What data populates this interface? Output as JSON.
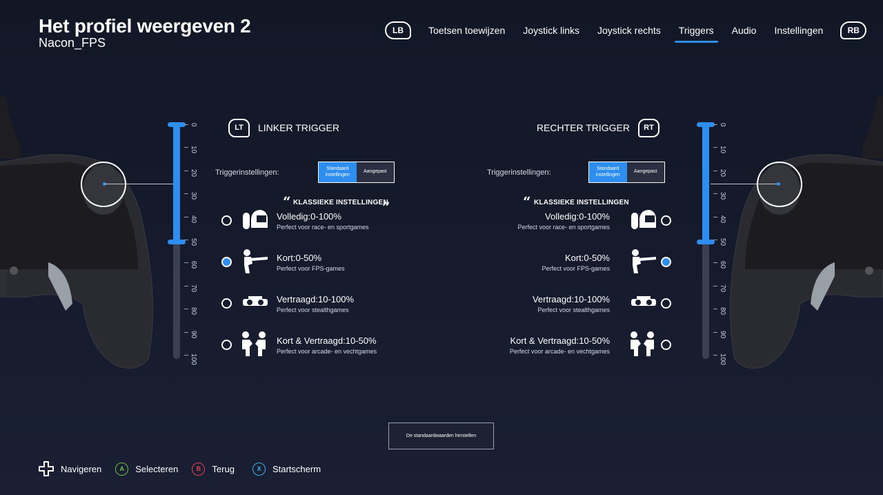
{
  "header": {
    "title": "Het profiel weergeven 2",
    "subtitle": "Nacon_FPS"
  },
  "nav": {
    "left_bumper": "LB",
    "right_bumper": "RB",
    "tabs": [
      {
        "label": "Toetsen toewijzen",
        "active": false
      },
      {
        "label": "Joystick links",
        "active": false
      },
      {
        "label": "Joystick rechts",
        "active": false
      },
      {
        "label": "Triggers",
        "active": true
      },
      {
        "label": "Audio",
        "active": false
      },
      {
        "label": "Instellingen",
        "active": false
      }
    ]
  },
  "slider": {
    "ticks": [
      "0",
      "10",
      "20",
      "30",
      "40",
      "50",
      "60",
      "70",
      "80",
      "90",
      "100"
    ],
    "value_percent": 50
  },
  "left_panel": {
    "icon": "LT",
    "title": "LINKER TRIGGER",
    "settings_label": "Triggerinstellingen:",
    "seg_standard": "Standaard instellingen",
    "seg_custom": "Aangepast",
    "section_title": "KLASSIEKE INSTELLINGEN",
    "options": [
      {
        "title": "Volledig:0-100%",
        "sub": "Perfect voor race- en sportgames",
        "icon": "helmet-icon",
        "checked": false
      },
      {
        "title": "Kort:0-50%",
        "sub": "Perfect voor FPS-games",
        "icon": "shooter-icon",
        "checked": true
      },
      {
        "title": "Vertraagd:10-100%",
        "sub": "Perfect voor stealthgames",
        "icon": "goggles-icon",
        "checked": false
      },
      {
        "title": "Kort & Vertraagd:10-50%",
        "sub": "Perfect voor arcade- en vechtgames",
        "icon": "fighters-icon",
        "checked": false
      }
    ]
  },
  "right_panel": {
    "icon": "RT",
    "title": "RECHTER TRIGGER",
    "settings_label": "Triggerinstellingen:",
    "seg_standard": "Standaard instellingen",
    "seg_custom": "Aangepast",
    "section_title": "KLASSIEKE INSTELLINGEN",
    "options": [
      {
        "title": "Volledig:0-100%",
        "sub": "Perfect voor race- en sportgames",
        "icon": "helmet-icon",
        "checked": false
      },
      {
        "title": "Kort:0-50%",
        "sub": "Perfect voor FPS-games",
        "icon": "shooter-icon",
        "checked": true
      },
      {
        "title": "Vertraagd:10-100%",
        "sub": "Perfect voor stealthgames",
        "icon": "goggles-icon",
        "checked": false
      },
      {
        "title": "Kort & Vertraagd:10-50%",
        "sub": "Perfect voor arcade- en vechtgames",
        "icon": "fighters-icon",
        "checked": false
      }
    ]
  },
  "reset_label": "De standaardwaarden herstellen",
  "footer": {
    "navigate": "Navigeren",
    "select_btn": "A",
    "select": "Selecteren",
    "back_btn": "B",
    "back": "Terug",
    "home_btn": "X",
    "home": "Startscherm"
  },
  "colors": {
    "accent": "#2e8ef0",
    "btn_a": "#6cc24a",
    "btn_b": "#e8414f",
    "btn_x": "#3fb6e8"
  }
}
